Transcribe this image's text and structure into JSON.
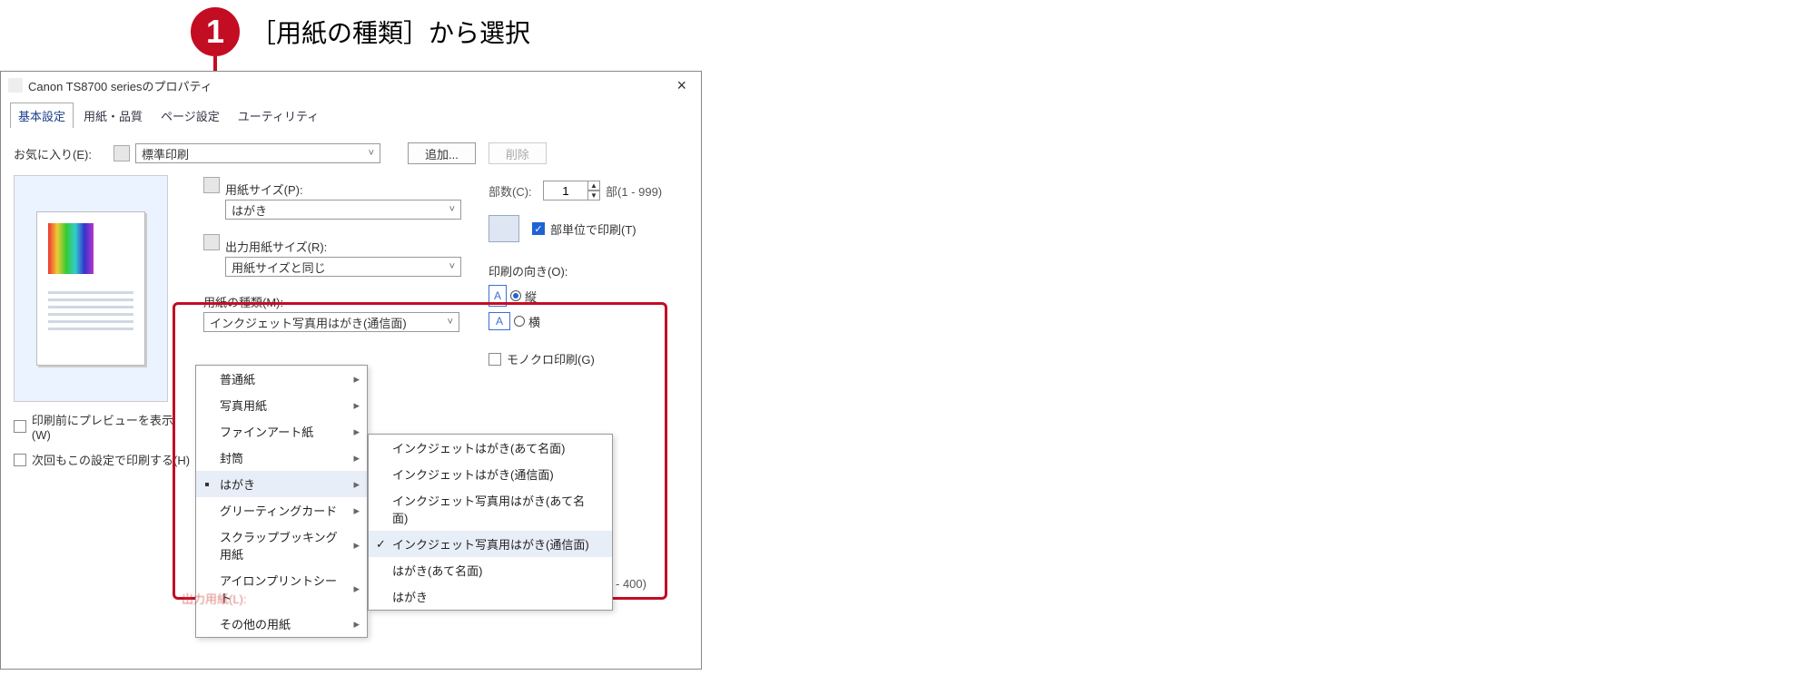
{
  "callout": {
    "num": "1",
    "text": "［用紙の種類］から選択"
  },
  "dialog": {
    "title": "Canon TS8700 seriesのプロパティ",
    "tabs": [
      "基本設定",
      "用紙・品質",
      "ページ設定",
      "ユーティリティ"
    ],
    "active_tab": 0,
    "favorites": {
      "label": "お気に入り(E):",
      "value": "標準印刷",
      "add": "追加...",
      "delete": "削除"
    },
    "paper_size": {
      "label": "用紙サイズ(P):",
      "value": "はがき"
    },
    "output_size": {
      "label": "出力用紙サイズ(R):",
      "value": "用紙サイズと同じ"
    },
    "media_type": {
      "label": "用紙の種類(M):",
      "value": "インクジェット写真用はがき(通信面)"
    },
    "copies": {
      "label": "部数(C):",
      "value": "1",
      "range": "部(1 - 999)"
    },
    "collate": {
      "label": "部単位で印刷(T)",
      "checked": true
    },
    "orientation": {
      "label": "印刷の向き(O):",
      "portrait": "縦",
      "landscape": "横",
      "selected": "portrait"
    },
    "mono": {
      "label": "モノクロ印刷(G)",
      "checked": false
    },
    "preview_before": {
      "label": "印刷前にプレビューを表示(W)",
      "checked": false
    },
    "always_use": {
      "label": "次回もこの設定で印刷する(H)",
      "checked": false
    },
    "truncated_hint": "- 400)",
    "truncated_bottom": "出力用紙(L):",
    "menu": {
      "items": [
        {
          "label": "普通紙",
          "sub": true
        },
        {
          "label": "写真用紙",
          "sub": true
        },
        {
          "label": "ファインアート紙",
          "sub": true
        },
        {
          "label": "封筒",
          "sub": true
        },
        {
          "label": "はがき",
          "sub": true,
          "active": true
        },
        {
          "label": "グリーティングカード",
          "sub": true
        },
        {
          "label": "スクラップブッキング用紙",
          "sub": true
        },
        {
          "label": "アイロンプリントシート",
          "sub": true
        },
        {
          "label": "その他の用紙",
          "sub": true
        }
      ],
      "submenu": [
        {
          "label": "インクジェットはがき(あて名面)"
        },
        {
          "label": "インクジェットはがき(通信面)"
        },
        {
          "label": "インクジェット写真用はがき(あて名面)"
        },
        {
          "label": "インクジェット写真用はがき(通信面)",
          "checked": true,
          "hover": true
        },
        {
          "label": "はがき(あて名面)"
        },
        {
          "label": "はがき"
        }
      ]
    }
  }
}
